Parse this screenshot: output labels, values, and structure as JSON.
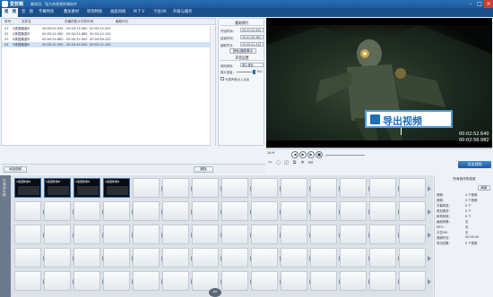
{
  "app": {
    "name": "爱剪辑",
    "subtitle": "最易用、强大的视频剪辑软件"
  },
  "window": {
    "minimize": "–",
    "maximize": "□",
    "close": "×"
  },
  "tabs": [
    {
      "label": "视　频"
    },
    {
      "label": "音　频"
    },
    {
      "label": "字幕特效"
    },
    {
      "label": "叠加素材"
    },
    {
      "label": "转场特效"
    },
    {
      "label": "画面风格"
    },
    {
      "label": "M T V"
    },
    {
      "label": "卡拉OK"
    },
    {
      "label": "升级与服务"
    }
  ],
  "video_list": {
    "columns": [
      "序号",
      "文件名",
      "在最终影片中的时间",
      "截取时长"
    ],
    "rows": [
      {
        "no": "01",
        "file": "X美国隆重Ⅲ",
        "time": "00:00:00.040 - 00:00:14.560",
        "dur": "00:00:14.520"
      },
      {
        "no": "02",
        "file": "X美国隆重Ⅲ",
        "time": "00:00:14.560 - 00:00:24.680",
        "dur": "00:00:10.120"
      },
      {
        "no": "03",
        "file": "X美国隆重Ⅲ",
        "time": "00:00:24.680 - 00:00:32.900",
        "dur": "00:00:08.220"
      },
      {
        "no": "04",
        "file": "X美国隆重Ⅲ",
        "time": "00:00:32.900 - 00:00:45.000",
        "dur": "00:00:12.100"
      }
    ]
  },
  "settings": {
    "trim_title": "截取原片",
    "start_label": "开始时间：",
    "start_value": "00:02:52.640",
    "end_label": "结束时间：",
    "end_value": "00:02:56.982",
    "dur_label": "截取时长：",
    "dur_value": "00:00:04.342",
    "pick_button": "快轨/播放果点",
    "audio_title": "声音设置",
    "track_label": "使用音轨：",
    "track_value": "原片音轨",
    "vol_label": "原片音量：",
    "vol_value": "100",
    "fade_label": "头尾声音淡入淡出",
    "confirm_button": "确认修改"
  },
  "bottom": {
    "add_video": "添加视频",
    "delete": "删除"
  },
  "preview": {
    "banner_text": "导出视频",
    "time_current": "00:02:52.640",
    "time_total": "00:02:56.982",
    "zoom": "16:9",
    "export_button": "导出视频"
  },
  "timeline": {
    "side_label": "已添加片段",
    "clips": [
      {
        "label": "X美国隆重Ⅲ"
      },
      {
        "label": "X美国隆重Ⅲ"
      },
      {
        "label": "X美国隆重Ⅲ"
      },
      {
        "label": "X美国隆重Ⅲ"
      }
    ],
    "watermark": "爱剪辑"
  },
  "right_panel": {
    "title": "所有制作的信息",
    "all_button": "刷新",
    "rows": [
      {
        "k": "视频：",
        "v": "4 个视频"
      },
      {
        "k": "音频：",
        "v": "0 个音频"
      },
      {
        "k": "字幕特效：",
        "v": "0 个"
      },
      {
        "k": "叠加素材：",
        "v": "0 个"
      },
      {
        "k": "转场特效：",
        "v": "0 个"
      },
      {
        "k": "画面风格：",
        "v": "无"
      },
      {
        "k": "MTV：",
        "v": "无"
      },
      {
        "k": "卡拉OK：",
        "v": "无"
      },
      {
        "k": "视频时长：",
        "v": "00:00:45"
      },
      {
        "k": "导出总数：",
        "v": "0 个视频"
      }
    ]
  },
  "colors": {
    "accent": "#1d5a9b",
    "banner": "#1e6fb5",
    "selection": "#cfe2f6"
  }
}
